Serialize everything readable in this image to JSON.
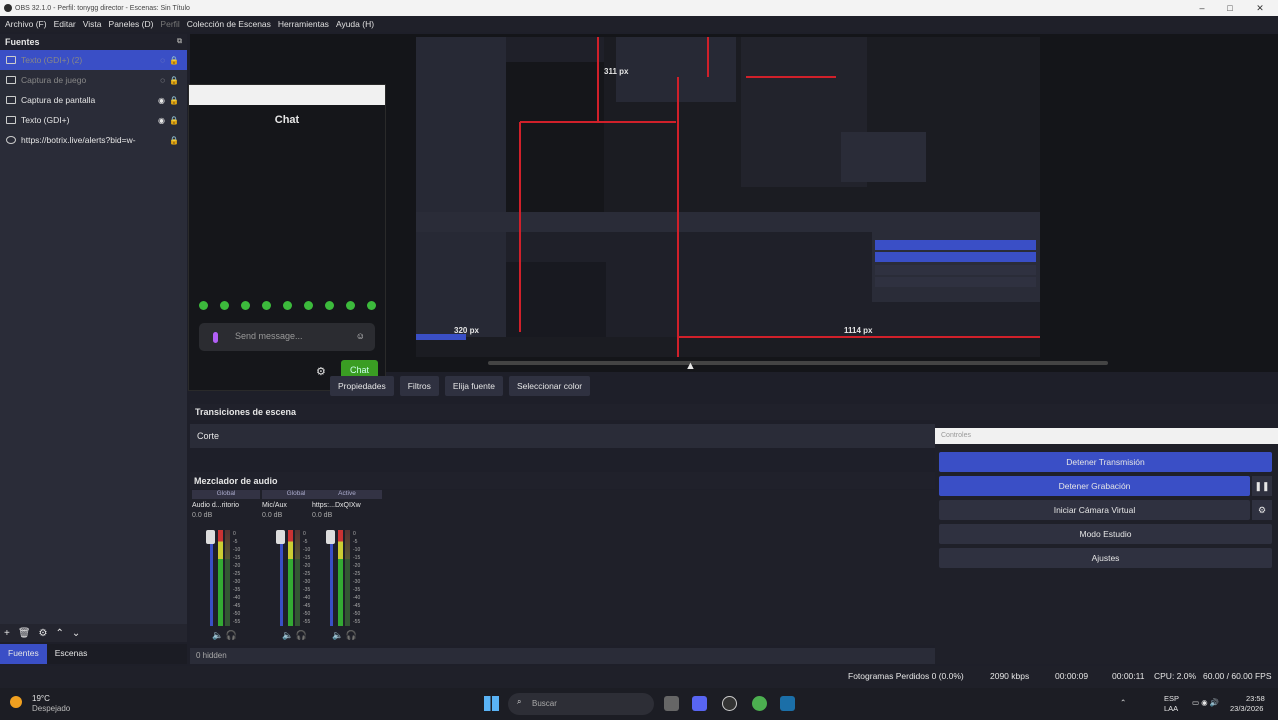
{
  "window": {
    "title": "OBS 32.1.0 - Perfil: tonygg director - Escenas: Sin Título"
  },
  "menu": [
    "Archivo (F)",
    "Editar",
    "Vista",
    "Paneles (D)",
    "Perfil",
    "Colección de Escenas",
    "Herramientas",
    "Ayuda (H)"
  ],
  "sources": {
    "title": "Fuentes",
    "items": [
      {
        "label": "Texto (GDI+) (2)"
      },
      {
        "label": "Captura de juego"
      },
      {
        "label": "Captura de pantalla"
      },
      {
        "label": "Texto (GDI+)"
      },
      {
        "label": "https://botrix.live/alerts?bid=w-"
      }
    ]
  },
  "dock_tabs": [
    "Fuentes",
    "Escenas"
  ],
  "chat": {
    "title": "Chat",
    "placeholder": "Send message...",
    "send_label": "Chat"
  },
  "preview_labels": {
    "top": "311 px",
    "left": "320 px",
    "right": "1114 px"
  },
  "toolbar": {
    "props": "Propiedades",
    "filters": "Filtros",
    "choose": "Elija fuente",
    "color": "Seleccionar color"
  },
  "transitions": {
    "title": "Transiciones de escena",
    "value": "Corte"
  },
  "mixer": {
    "title": "Mezclador de audio",
    "channels": [
      {
        "tag": "Global",
        "name": "Audio d...ritorio",
        "db": "0.0 dB"
      },
      {
        "tag": "Global",
        "name": "Mic/Aux",
        "db": "0.0 dB"
      },
      {
        "tag": "Active",
        "name": "https:...DxQIXw",
        "db": "0.0 dB"
      }
    ],
    "hidden": "0 hidden",
    "scale": [
      "0",
      "-5",
      "-10",
      "-15",
      "-20",
      "-25",
      "-30",
      "-35",
      "-40",
      "-45",
      "-50",
      "-55",
      "-60"
    ]
  },
  "controls": {
    "title": "Controles",
    "stream": "Detener Transmisión",
    "record": "Detener Grabación",
    "vcam": "Iniciar Cámara Virtual",
    "studio": "Modo Estudio",
    "settings": "Ajustes"
  },
  "status": {
    "dropped": "Fotogramas Perdidos 0 (0.0%)",
    "kbps": "2090 kbps",
    "stream_time": "00:00:09",
    "rec_time": "00:00:11",
    "cpu": "CPU: 2.0%",
    "fps": "60.00 / 60.00 FPS"
  },
  "taskbar": {
    "temp": "19°C",
    "weather": "Despejado",
    "search": "Buscar",
    "lang1": "ESP",
    "lang2": "LAA",
    "time": "23:58",
    "date": "23/3/2026"
  }
}
